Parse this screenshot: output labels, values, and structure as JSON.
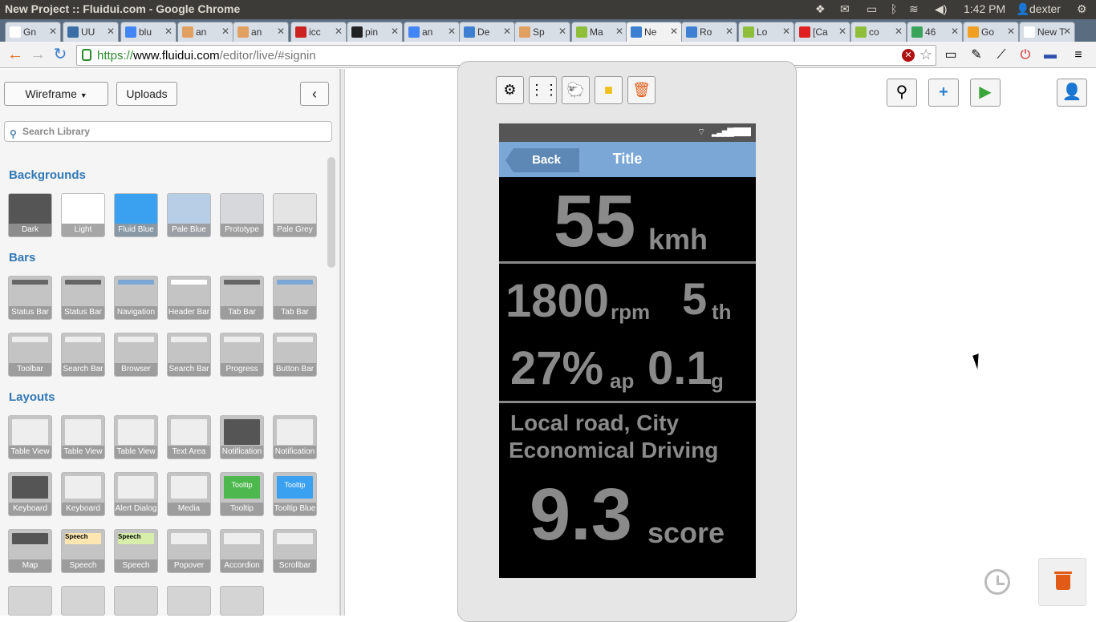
{
  "topbar": {
    "window_title": "New Project :: Fluidui.com - Google Chrome",
    "time": "1:42 PM",
    "user": "dexter"
  },
  "tabs": [
    {
      "label": "Gn",
      "color": "#ffffff"
    },
    {
      "label": "UU",
      "color": "#3a6ea5"
    },
    {
      "label": "blu",
      "color": "#4285f4"
    },
    {
      "label": "an",
      "color": "#e0a060"
    },
    {
      "label": "an",
      "color": "#e0a060"
    },
    {
      "label": "icc",
      "color": "#cc2222"
    },
    {
      "label": "pin",
      "color": "#222222"
    },
    {
      "label": "an",
      "color": "#4285f4"
    },
    {
      "label": "De",
      "color": "#3d7fd1"
    },
    {
      "label": "Sp",
      "color": "#e0a060"
    },
    {
      "label": "Ma",
      "color": "#8fbf3a"
    },
    {
      "label": "Ne",
      "color": "#3d7fd1"
    },
    {
      "label": "Ro",
      "color": "#3d7fd1"
    },
    {
      "label": "Lo",
      "color": "#8fbf3a"
    },
    {
      "label": "[Ca",
      "color": "#e02020"
    },
    {
      "label": "co",
      "color": "#8fbf3a"
    },
    {
      "label": "46",
      "color": "#3aa55a"
    },
    {
      "label": "Go",
      "color": "#f0a020"
    },
    {
      "label": "New T",
      "color": "#ffffff"
    }
  ],
  "address": {
    "scheme": "https://",
    "host": "www.fluidui.com",
    "path": "/editor/live/#signin"
  },
  "left": {
    "wireframe_label": "Wireframe",
    "uploads_label": "Uploads",
    "search_placeholder": "Search Library",
    "sections": {
      "backgrounds": "Backgrounds",
      "bars": "Bars",
      "layouts": "Layouts"
    },
    "backgrounds": [
      {
        "label": "Dark",
        "color": "#555555"
      },
      {
        "label": "Light",
        "color": "#ffffff"
      },
      {
        "label": "Fluid Blue",
        "color": "#3aa0f0"
      },
      {
        "label": "Pale Blue",
        "color": "#b8cde6"
      },
      {
        "label": "Prototype",
        "color": "#d6d8dc"
      },
      {
        "label": "Pale Grey",
        "color": "#e4e4e4"
      }
    ],
    "bars_row1": [
      "Status Bar",
      "Status Bar",
      "Navigation",
      "Header Bar",
      "Tab Bar",
      "Tab Bar"
    ],
    "bars_row2": [
      "Toolbar",
      "Search Bar",
      "Browser",
      "Search Bar",
      "Progress",
      "Button Bar"
    ],
    "layouts_row1": [
      "Table View",
      "Table View",
      "Table View",
      "Text Area",
      "Notification",
      "Notification"
    ],
    "layouts_row2": [
      "Keyboard",
      "Keyboard",
      "Alert Dialog",
      "Media",
      "Tooltip",
      "Tooltip Blue"
    ],
    "layouts_row3": [
      "Map",
      "Speech",
      "Speech",
      "Popover",
      "Accordion",
      "Scrollbar"
    ],
    "tooltip_text": "Tooltip",
    "speech_text": "Speech"
  },
  "phone": {
    "back_label": "Back",
    "title": "Title",
    "speed_value": "55",
    "speed_unit": "kmh",
    "rpm_value": "1800",
    "rpm_unit": "rpm",
    "gear_value": "5",
    "gear_suffix": "th",
    "ap_value": "27%",
    "ap_unit": "ap",
    "g_value": "0.1",
    "g_unit": "g",
    "road": "Local road, City",
    "mode": "Economical Driving",
    "score_value": "9.3",
    "score_unit": "score"
  },
  "colors": {
    "accent": "#3178b6",
    "nav_blue": "#7aa7d6",
    "trash_orange": "#e25b16"
  }
}
